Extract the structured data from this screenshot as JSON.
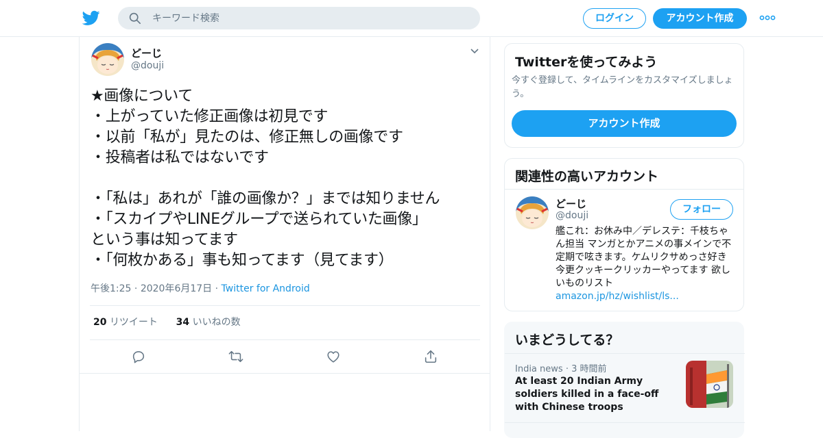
{
  "header": {
    "search_placeholder": "キーワード検索",
    "login_label": "ログイン",
    "signup_label": "アカウント作成"
  },
  "tweet": {
    "name": "どーじ",
    "handle": "@douji",
    "text": "★画像について\n・上がっていた修正画像は初見です\n・以前「私が」見たのは、修正無しの画像です\n・投稿者は私ではないです\n\n・「私は」あれが「誰の画像か？」までは知りません\n・「スカイプやLINEグループで送られていた画像」\nという事は知ってます\n・「何枚かある」事も知ってます（見てます）",
    "time": "午後1:25",
    "date": "2020年6月17日",
    "source": "Twitter for Android",
    "retweets_count": "20",
    "retweets_label": "リツイート",
    "likes_count": "34",
    "likes_label": "いいねの数"
  },
  "sidebar": {
    "signup_card": {
      "title": "Twitterを使ってみよう",
      "description": "今すぐ登録して、タイムラインをカスタマイズしましょう。",
      "button": "アカウント作成"
    },
    "related_card": {
      "title": "関連性の高いアカウント",
      "name": "どーじ",
      "handle": "@douji",
      "follow_label": "フォロー",
      "bio": "艦これ：お休み中／デレステ：千枝ちゃん担当 マンガとかアニメの事メインで不定期で呟きます。ケムリクサめっさ好き 今更クッキークリッカーやってます 欲しいものリスト",
      "link": "amazon.jp/hz/wishlist/ls..."
    },
    "trends_card": {
      "title": "いまどうしてる？",
      "category": "India news",
      "time": "3 時間前",
      "headline": "At least 20 Indian Army soldiers killed in a face-off with Chinese troops"
    }
  },
  "colors": {
    "accent": "#1da1f2",
    "link": "#1b95e0",
    "muted": "#657786",
    "border": "#e6ecf0"
  }
}
